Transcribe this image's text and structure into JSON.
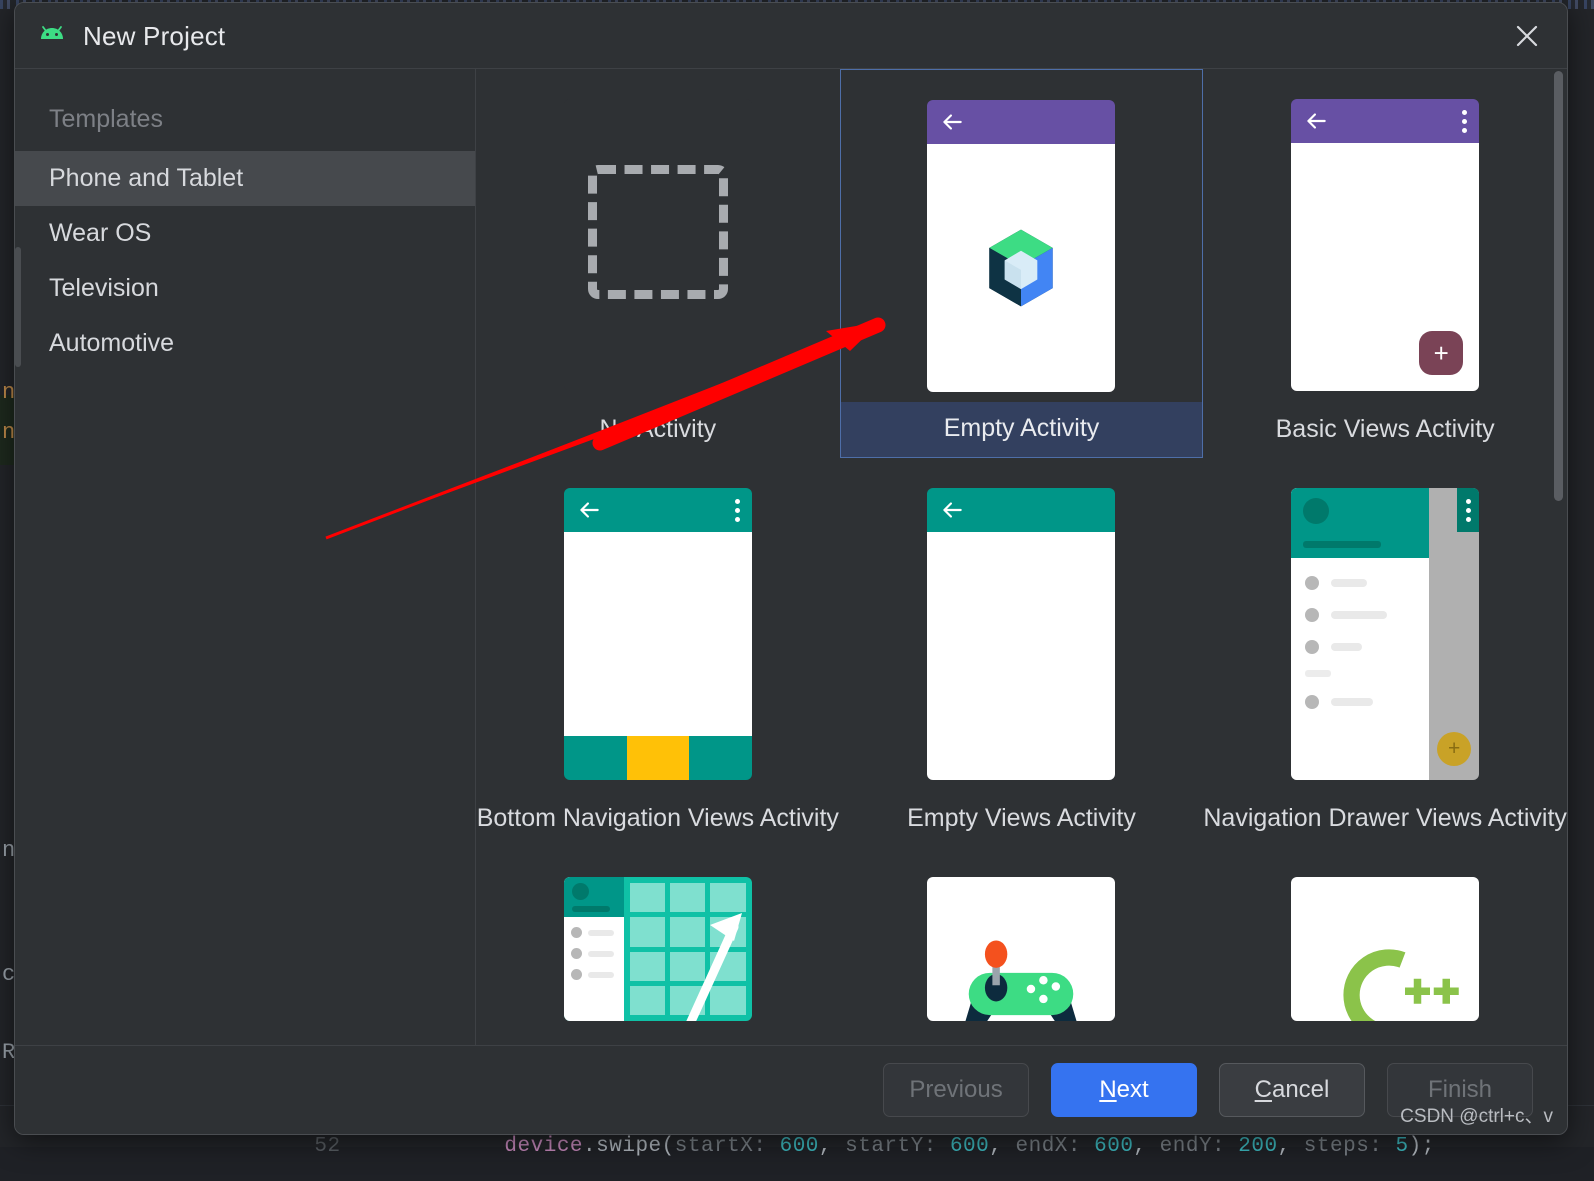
{
  "background": {
    "code_line": "device.swipe( startX: 600, startY: 600, endX: 600, endY: 200, steps: 5);",
    "gutter_number": "52",
    "left_chars": [
      "n",
      "n",
      "n",
      "c",
      "R"
    ],
    "code_tokens": {
      "object": "device",
      "method": ".swipe(",
      "p1_label": "startX:",
      "p1_value": "600",
      "p2_label": "startY:",
      "p2_value": "600",
      "p3_label": "endX:",
      "p3_value": "600",
      "p4_label": "endY:",
      "p4_value": "200",
      "p5_label": "steps:",
      "p5_value": "5"
    }
  },
  "dialog": {
    "title": "New Project",
    "icon": "android-icon",
    "close_icon": "close-icon"
  },
  "sidebar": {
    "heading": "Templates",
    "items": [
      {
        "label": "Phone and Tablet",
        "selected": true
      },
      {
        "label": "Wear OS",
        "selected": false
      },
      {
        "label": "Television",
        "selected": false
      },
      {
        "label": "Automotive",
        "selected": false
      }
    ]
  },
  "templates": {
    "selected": "Empty Activity",
    "items": [
      {
        "label": "No Activity",
        "thumb": "no-activity",
        "selected": false
      },
      {
        "label": "Empty Activity",
        "thumb": "empty-activity",
        "selected": true
      },
      {
        "label": "Basic Views Activity",
        "thumb": "basic-views-activity",
        "selected": false
      },
      {
        "label": "Bottom Navigation Views Activity",
        "thumb": "bottom-nav-activity",
        "selected": false
      },
      {
        "label": "Empty Views Activity",
        "thumb": "empty-views-activity",
        "selected": false
      },
      {
        "label": "Navigation Drawer Views Activity",
        "thumb": "nav-drawer-activity",
        "selected": false
      },
      {
        "label": "",
        "thumb": "responsive-activity",
        "selected": false
      },
      {
        "label": "",
        "thumb": "game-activity",
        "selected": false
      },
      {
        "label": "",
        "thumb": "native-cpp-activity",
        "selected": false
      }
    ]
  },
  "buttons": {
    "previous": "Previous",
    "next_prefix": "N",
    "next_rest": "ext",
    "cancel_prefix": "C",
    "cancel_rest": "ancel",
    "finish": "Finish"
  },
  "watermark": "CSDN @ctrl+c、v",
  "colors": {
    "accent_blue": "#3573f0",
    "selection_blue": "#33405f",
    "selection_border": "#4e6ea8",
    "material_purple": "#6750A4",
    "material_teal": "#009688",
    "amber": "#FFC107",
    "annotation_red": "#FF0000",
    "dialog_bg": "#2e3134",
    "sidebar_selected": "#46494d"
  },
  "annotation": {
    "type": "arrow",
    "points_to": "Empty Activity",
    "color": "#FF0000"
  }
}
